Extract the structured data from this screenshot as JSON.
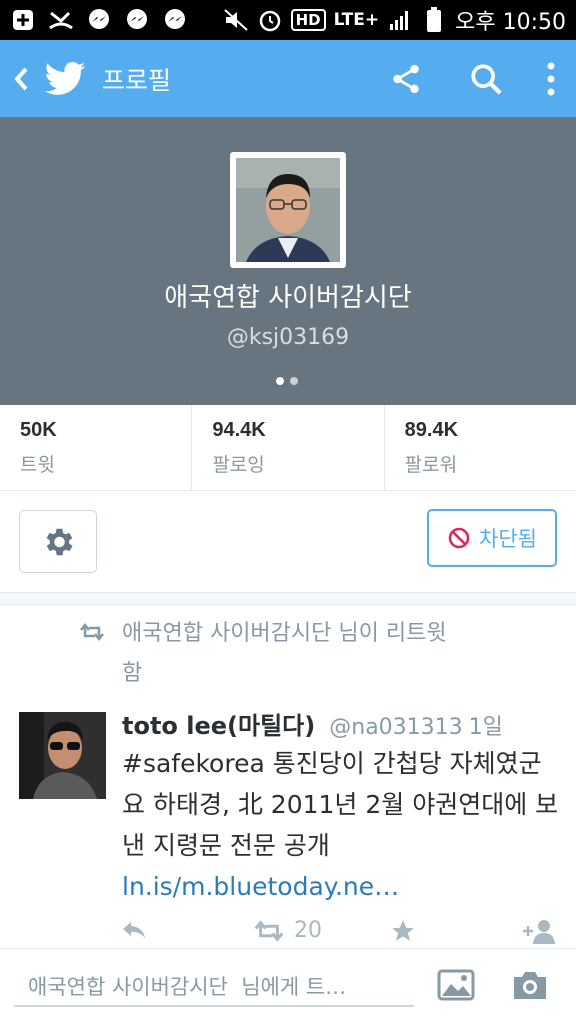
{
  "status_bar": {
    "network": "LTE+",
    "hd": "HD",
    "time": "오후 10:50"
  },
  "app_bar": {
    "title": "프로필"
  },
  "profile": {
    "display_name": "애국연합 사이버감시단",
    "handle": "@ksj03169"
  },
  "stats": [
    {
      "value": "50K",
      "label": "트윗"
    },
    {
      "value": "94.4K",
      "label": "팔로잉"
    },
    {
      "value": "89.4K",
      "label": "팔로워"
    }
  ],
  "actions": {
    "blocked_label": "차단됨"
  },
  "tweet": {
    "retweet_context": "애국연합 사이버감시단  님이 리트윗함",
    "name": "toto lee(마틸다)",
    "handle": "@na031313",
    "time": "1일",
    "text": "#safekorea  통진당이 간첩당 자체였군요  하태경, 北 2011년 2월 야권연대에 보낸 지령문 전문 공개 ",
    "link": "ln.is/m.bluetoday.ne…",
    "retweet_count": "20"
  },
  "compose": {
    "placeholder": "애국연합 사이버감시단  님에게 트…"
  },
  "colors": {
    "twitter_blue": "#55acee",
    "header_gray": "#66757f",
    "link": "#2b7bb9"
  }
}
